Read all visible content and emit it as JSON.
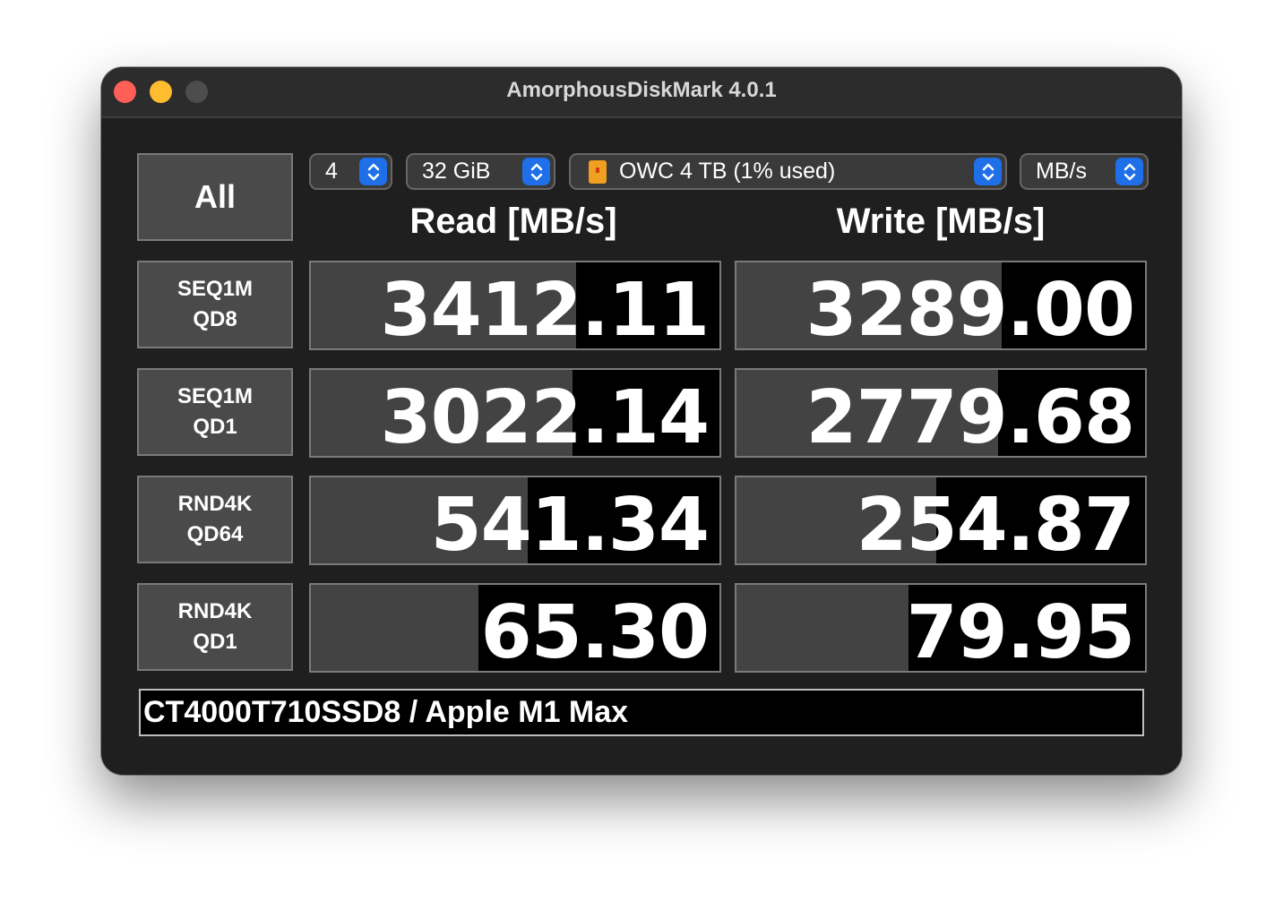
{
  "window": {
    "title": "AmorphousDiskMark 4.0.1"
  },
  "controls": {
    "all_label": "All",
    "count": "4",
    "size": "32 GiB",
    "drive": "OWC 4 TB (1% used)",
    "unit": "MB/s"
  },
  "columns": {
    "read": "Read [MB/s]",
    "write": "Write [MB/s]"
  },
  "tests": [
    {
      "line1": "SEQ1M",
      "line2": "QD8",
      "read": "3412.11",
      "write": "3289.00",
      "read_fill": 0.65,
      "write_fill": 0.65
    },
    {
      "line1": "SEQ1M",
      "line2": "QD1",
      "read": "3022.14",
      "write": "2779.68",
      "read_fill": 0.64,
      "write_fill": 0.64
    },
    {
      "line1": "RND4K",
      "line2": "QD64",
      "read": "541.34",
      "write": "254.87",
      "read_fill": 0.53,
      "write_fill": 0.49
    },
    {
      "line1": "RND4K",
      "line2": "QD1",
      "read": "65.30",
      "write": "79.95",
      "read_fill": 0.41,
      "write_fill": 0.42
    }
  ],
  "comment": "CT4000T710SSD8 / Apple M1 Max",
  "colors": {
    "window_bg": "#1f1f1f",
    "fill": "#434343",
    "accent": "#1f6fe8",
    "close": "#fe5f57",
    "minimize": "#febc2e"
  }
}
